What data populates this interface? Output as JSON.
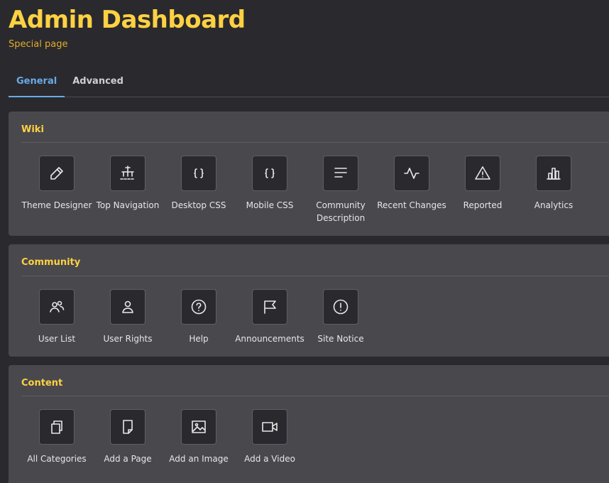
{
  "header": {
    "title": "Admin Dashboard",
    "subtitle": "Special page"
  },
  "tabs": [
    {
      "label": "General",
      "active": true
    },
    {
      "label": "Advanced",
      "active": false
    }
  ],
  "sections": [
    {
      "title": "Wiki",
      "items": [
        {
          "label": "Theme Designer",
          "icon": "pencil-icon"
        },
        {
          "label": "Top Navigation",
          "icon": "sitemap-icon"
        },
        {
          "label": "Desktop CSS",
          "icon": "code-braces-icon"
        },
        {
          "label": "Mobile CSS",
          "icon": "code-braces-icon"
        },
        {
          "label": "Community Description",
          "icon": "text-lines-icon"
        },
        {
          "label": "Recent Changes",
          "icon": "activity-icon"
        },
        {
          "label": "Reported",
          "icon": "warning-icon"
        },
        {
          "label": "Analytics",
          "icon": "bar-chart-icon"
        }
      ]
    },
    {
      "title": "Community",
      "items": [
        {
          "label": "User List",
          "icon": "users-icon"
        },
        {
          "label": "User Rights",
          "icon": "user-icon"
        },
        {
          "label": "Help",
          "icon": "question-icon"
        },
        {
          "label": "Announcements",
          "icon": "flag-icon"
        },
        {
          "label": "Site Notice",
          "icon": "alert-circle-icon"
        }
      ]
    },
    {
      "title": "Content",
      "items": [
        {
          "label": "All Categories",
          "icon": "copy-icon"
        },
        {
          "label": "Add a Page",
          "icon": "page-icon"
        },
        {
          "label": "Add an Image",
          "icon": "image-icon"
        },
        {
          "label": "Add a Video",
          "icon": "video-icon"
        }
      ]
    }
  ],
  "colors": {
    "background": "#2a292e",
    "panel": "#49484d",
    "accent_yellow": "#fdd142",
    "subtitle_orange": "#e0ad2a",
    "tab_active": "#69abe6"
  }
}
